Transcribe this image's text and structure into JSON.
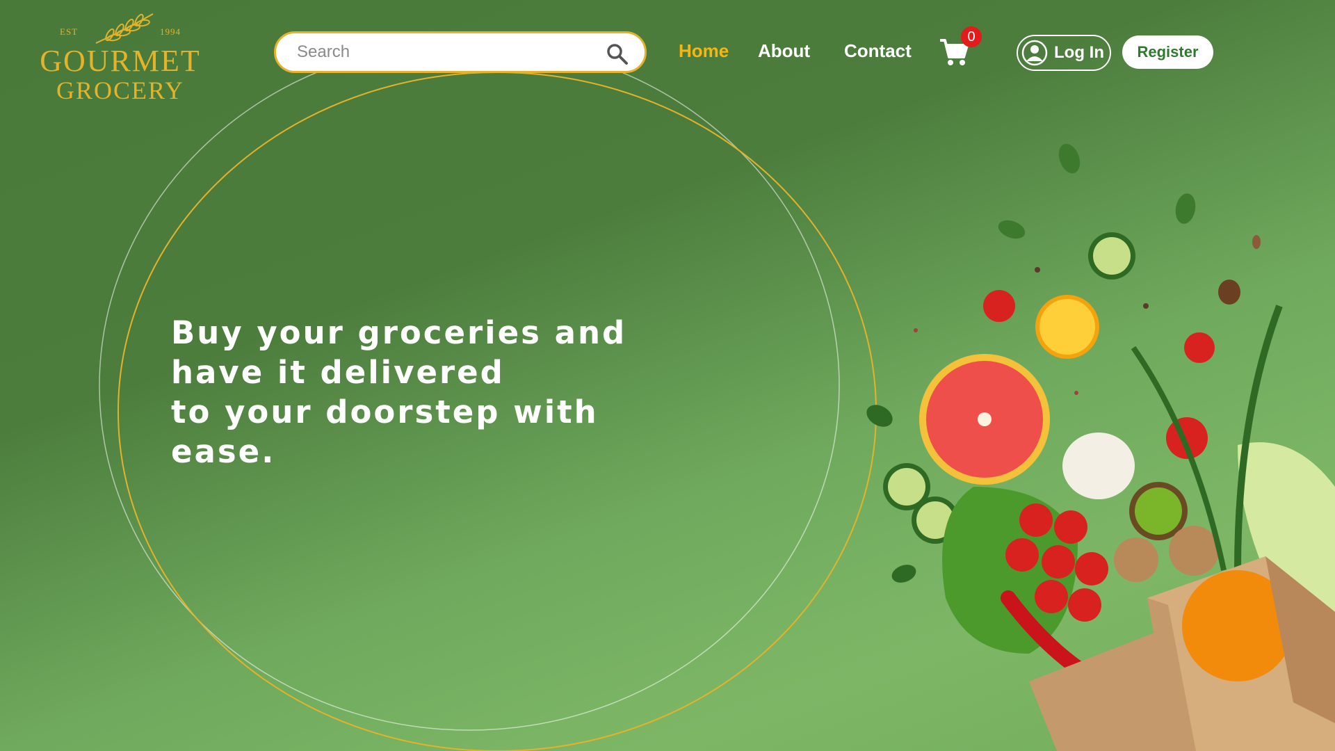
{
  "logo": {
    "est": "EST",
    "year": "1994",
    "line1": "GOURMET",
    "line2": "GROCERY"
  },
  "search": {
    "placeholder": "Search",
    "icon": "search-icon"
  },
  "nav": {
    "home": "Home",
    "about": "About",
    "contact": "Contact"
  },
  "cart": {
    "icon": "cart-icon",
    "count": "0"
  },
  "auth": {
    "login_label": "Log In",
    "register_label": "Register"
  },
  "hero": {
    "line1": "Buy your groceries and",
    "line2": "have it delivered",
    "line3": "to your doorstep with",
    "line4": "ease."
  },
  "colors": {
    "accent_gold": "#e4b22b",
    "active_nav": "#f5b60f",
    "badge_red": "#e21b1b",
    "register_text": "#2f7a2e"
  }
}
